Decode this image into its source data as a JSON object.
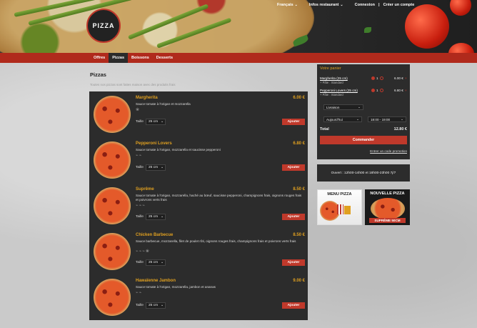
{
  "header": {
    "logo_text": "PIZZA",
    "nav": {
      "language": "Français",
      "restaurant_info": "Infos restaurant",
      "login": "Connexion",
      "separator": "|",
      "signup": "Créer un compte"
    }
  },
  "categories": [
    {
      "label": "Offres"
    },
    {
      "label": "Pizzas",
      "active": true
    },
    {
      "label": "Boissons"
    },
    {
      "label": "Desserts"
    }
  ],
  "section": {
    "title": "Pizzas",
    "description": "Toutes nos pizzas sont faites maison avec des produits frais"
  },
  "items": [
    {
      "name": "Margherita",
      "price": "6.00 €",
      "description": "Sauce tomate à l'origan et mozzarella",
      "icons": "❀",
      "size_label": "Taille",
      "size_value": "25 cm",
      "add_label": "Ajouter"
    },
    {
      "name": "Pepperoni Lovers",
      "price": "6.80 €",
      "description": "Sauce tomate à l'origan, mozzarella et saucisse pepperoni",
      "icons": "⌁⌁",
      "size_label": "Taille",
      "size_value": "25 cm",
      "add_label": "Ajouter"
    },
    {
      "name": "Suprême",
      "price": "8.50 €",
      "description": "Sauce tomate à l'origan, mozzarella, haché au bœuf, saucisse pepperoni, champignons frais, oignons rouges frais et poivrons verts frais",
      "icons": "⌁⌁⌁",
      "size_label": "Taille",
      "size_value": "25 cm",
      "add_label": "Ajouter"
    },
    {
      "name": "Chicken Barbecue",
      "price": "8.50 €",
      "description": "Sauce barbecue, mozzarella, filet de poulet rôti, oignons rouges frais, champignons frais et poivrons verts frais",
      "icons": "⌁⌁⌁❀",
      "size_label": "Taille",
      "size_value": "25 cm",
      "add_label": "Ajouter"
    },
    {
      "name": "Hawaïenne Jambon",
      "price": "9.00 €",
      "description": "Sauce tomate à l'origan, mozzarella, jambon et ananas",
      "icons": "⌁⌁",
      "size_label": "Taille",
      "size_value": "25 cm",
      "add_label": "Ajouter"
    }
  ],
  "cart": {
    "title": "Votre panier",
    "lines": [
      {
        "name": "Margherita (25 cm)",
        "sub": "+ Pâte : Standard",
        "qty": "1",
        "price": "6.00 €",
        "remove": "×"
      },
      {
        "name": "Pepperoni Lovers (25 cm)",
        "sub": "+ Pâte : Standard",
        "qty": "1",
        "price": "6.80 €",
        "remove": "×"
      }
    ],
    "mode": "Livraison",
    "day": "Aujourd'hui",
    "time": "18:00 - 19:00",
    "total_label": "Total",
    "total_value": "12.80 €",
    "order_label": "Commander",
    "promo_link": "Entrer un code promotion"
  },
  "hours": "Ouvert : 12h00-14h00 et 18h00-23h00 7j/7",
  "promos": [
    {
      "title": "MENU PIZZA"
    },
    {
      "title": "NOUVELLE PIZZA",
      "ribbon": "SUPRÊME 50CM"
    }
  ],
  "colors": {
    "accent_red": "#c0392b",
    "gold": "#e0a020",
    "panel": "#2c2c2c"
  }
}
